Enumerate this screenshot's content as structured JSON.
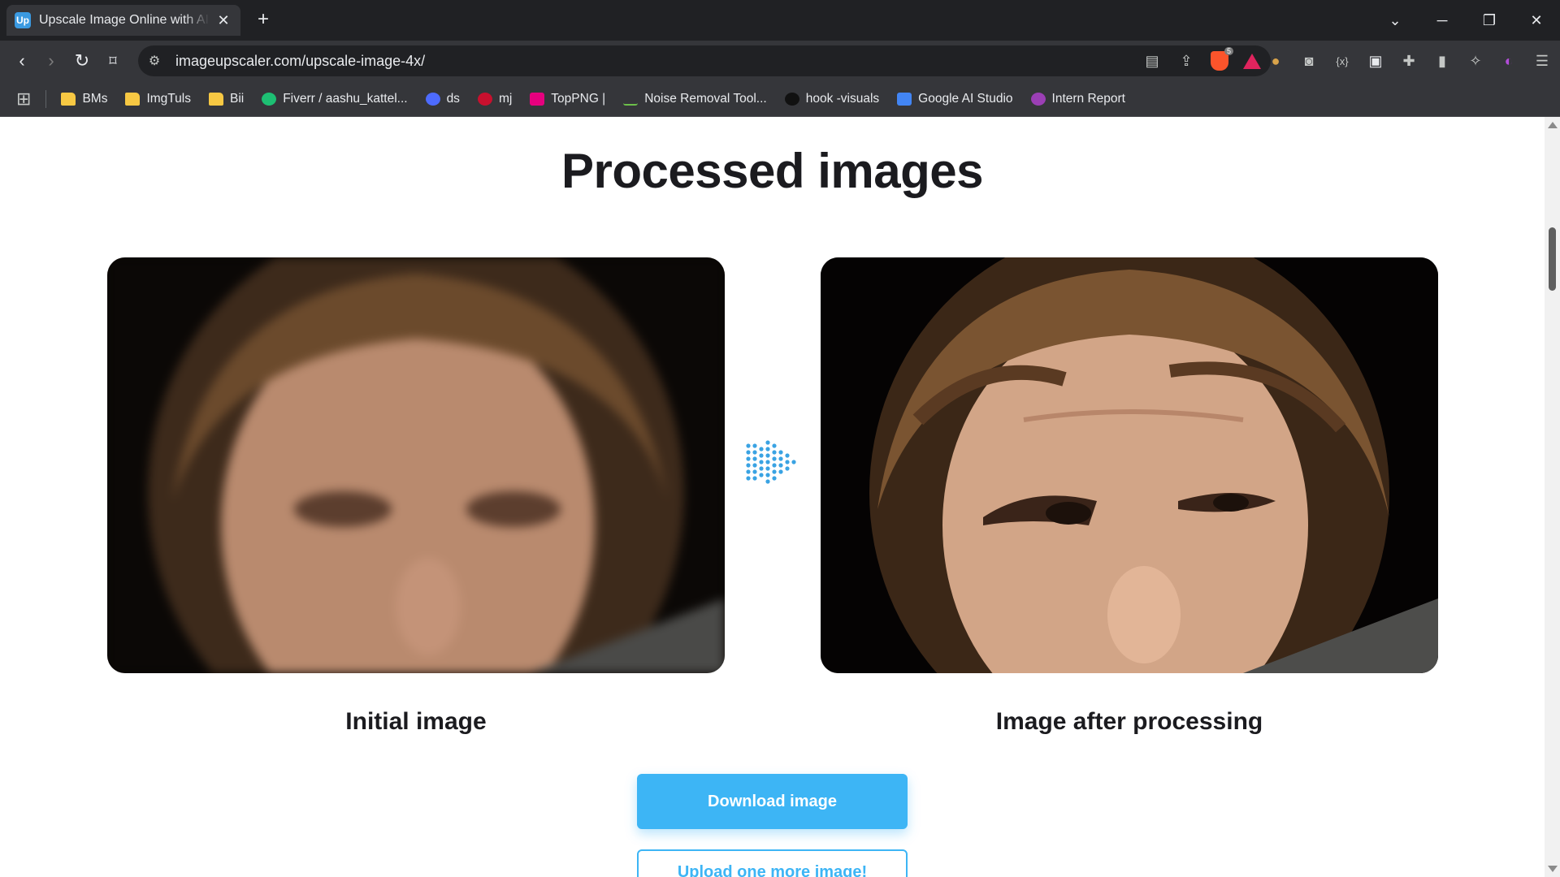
{
  "browser": {
    "tab_title": "Upscale Image Online with AI -",
    "tab_favicon": "Up",
    "url": "imageupscaler.com/upscale-image-4x/",
    "brave_badge": "5",
    "bookmarks": [
      {
        "label": "BMs",
        "icon": "folder-icon"
      },
      {
        "label": "ImgTuls",
        "icon": "folder-icon"
      },
      {
        "label": "Bii",
        "icon": "folder-icon"
      },
      {
        "label": "Fiverr / aashu_kattel...",
        "icon": "fiverr-icon"
      },
      {
        "label": "ds",
        "icon": "ds-icon"
      },
      {
        "label": "mj",
        "icon": "mj-icon"
      },
      {
        "label": "TopPNG |",
        "icon": "toppng-icon"
      },
      {
        "label": "Noise Removal Tool...",
        "icon": "noise-icon"
      },
      {
        "label": "hook -visuals",
        "icon": "tiktok-icon"
      },
      {
        "label": "Google AI Studio",
        "icon": "ai-studio-icon"
      },
      {
        "label": "Intern Report",
        "icon": "report-icon"
      }
    ]
  },
  "page": {
    "title": "Processed images",
    "initial_caption": "Initial image",
    "processed_caption": "Image after processing",
    "download_label": "Download image",
    "upload_label": "Upload one more image!"
  },
  "colors": {
    "accent": "#3db5f5",
    "heading": "#1b1b1f",
    "chrome_dark": "#202124",
    "chrome_mid": "#35363a"
  }
}
